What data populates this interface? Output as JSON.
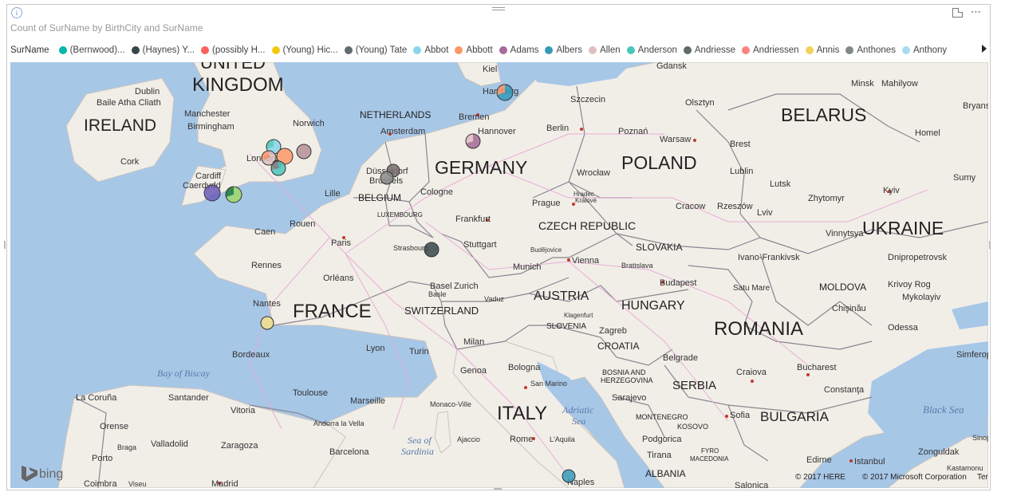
{
  "visual": {
    "title": "Count of SurName by BirthCity and SurName",
    "info_icon": "info-icon",
    "focus_icon": "focus-mode-icon",
    "more_icon": "more-options-icon",
    "more_glyph": "⋯"
  },
  "legend": {
    "title": "SurName",
    "items": [
      {
        "label": "(Bernwood)...",
        "color": "#01b8aa"
      },
      {
        "label": "(Haynes) Y...",
        "color": "#374649"
      },
      {
        "label": "(possibly H...",
        "color": "#fd625e"
      },
      {
        "label": "(Young) Hic...",
        "color": "#f2c80f"
      },
      {
        "label": "(Young) Tate",
        "color": "#5f6b6d"
      },
      {
        "label": "Abbot",
        "color": "#8ad4eb"
      },
      {
        "label": "Abbott",
        "color": "#fe9666"
      },
      {
        "label": "Adams",
        "color": "#a66999"
      },
      {
        "label": "Albers",
        "color": "#3599b8"
      },
      {
        "label": "Allen",
        "color": "#dfbfbf"
      },
      {
        "label": "Anderson",
        "color": "#4ac5bb"
      },
      {
        "label": "Andriesse",
        "color": "#5f6b6d"
      },
      {
        "label": "Andriessen",
        "color": "#fb8281"
      },
      {
        "label": "Annis",
        "color": "#f4d25a"
      },
      {
        "label": "Anthones",
        "color": "#7f898a"
      },
      {
        "label": "Anthony",
        "color": "#a4ddee"
      }
    ]
  },
  "map": {
    "countries": [
      "UNITED KINGDOM",
      "IRELAND",
      "NETHERLANDS",
      "GERMANY",
      "POLAND",
      "BELARUS",
      "BELGIUM",
      "LUXEMBOURG",
      "CZECH REPUBLIC",
      "SLOVAKIA",
      "UKRAINE",
      "FRANCE",
      "SWITZERLAND",
      "AUSTRIA",
      "HUNGARY",
      "ROMANIA",
      "MOLDOVA",
      "SLOVENIA",
      "CROATIA",
      "BOSNIA AND HERZEGOVINA",
      "SERBIA",
      "ITALY",
      "MONTENEGRO",
      "KOSOVO",
      "FYRO MACEDONIA",
      "BULGARIA",
      "ALBANIA"
    ],
    "seas": [
      "Bay of Biscay",
      "Adriatic Sea",
      "Sea of Sardinia",
      "Black Sea"
    ],
    "cities": [
      "Dublin",
      "Baile Atha Cliath",
      "Manchester",
      "Birmingham",
      "Norwich",
      "Cork",
      "Cardiff",
      "Caerdydd",
      "London",
      "Amsterdam",
      "Bremen",
      "Hannover",
      "Hamburg",
      "Kiel",
      "Gdansk",
      "Szczecin",
      "Olsztyn",
      "Minsk",
      "Mahilyow",
      "Bryansk",
      "Homel",
      "Berlin",
      "Poznan",
      "Warsaw",
      "Brest",
      "Lublin",
      "Wroclaw",
      "Dusseldorf",
      "Brussels",
      "Lille",
      "Cologne",
      "Prague",
      "Hradec Kralove",
      "Cracow",
      "Rzeszow",
      "Lviv",
      "Lutsk",
      "Zhytomyr",
      "Kyiv",
      "Sumy",
      "Vinnytsya",
      "Dnipropetrovsk",
      "Ivano-Frankivsk",
      "Krivoy Rog",
      "Mykolayiv",
      "Chisinau",
      "Odessa",
      "Simferopol",
      "Frankfurt",
      "Rouen",
      "Caen",
      "Paris",
      "Rennes",
      "Strasbourg",
      "Stuttgart",
      "Budejovice",
      "Vienna",
      "Bratislava",
      "Munich",
      "Orleans",
      "Basel",
      "Zurich",
      "Vaduz",
      "Budapest",
      "Satu Mare",
      "Nantes",
      "Klagenfurt",
      "Zagreb",
      "Milan",
      "Turin",
      "Genoa",
      "Bologna",
      "Belgrade",
      "Craiova",
      "Bucharest",
      "Constanta",
      "Lyon",
      "Bordeaux",
      "Sarajevo",
      "San Marino",
      "Toulouse",
      "Marseille",
      "Monaco-Ville",
      "Vitoria",
      "Santander",
      "La Coruna",
      "Orense",
      "Braga",
      "Valladolid",
      "Zaragoza",
      "Andorra la Vella",
      "Barcelona",
      "Ajaccio",
      "Rome",
      "L'Aquila",
      "Podgorica",
      "Tirana",
      "Sofia",
      "Edirne",
      "Istanbul",
      "Zonguldak",
      "Kastamonu",
      "Porto",
      "Coimbra",
      "Viseu",
      "Madrid",
      "Naples",
      "Salonica",
      "Sinop"
    ],
    "zoom_value": "",
    "logo": "bing",
    "copyright": "© 2017 HERE",
    "copyright2": "© 2017 Microsoft Corporation",
    "terms": "Ter"
  },
  "bubbles": [
    {
      "city": "Hamburg",
      "colors": [
        "#3599b8",
        "#fe9666"
      ]
    },
    {
      "city": "Hannover",
      "colors": [
        "#a66999",
        "#dfbfbf"
      ]
    },
    {
      "city": "London-1",
      "colors": [
        "#8ad4eb",
        "#4ac5bb"
      ]
    },
    {
      "city": "London-2",
      "colors": [
        "#fe9666"
      ]
    },
    {
      "city": "London-3",
      "colors": [
        "#dfbfbf",
        "#fe9666"
      ]
    },
    {
      "city": "London-4",
      "colors": [
        "#a66999"
      ]
    },
    {
      "city": "London-5",
      "colors": [
        "#4ac5bb",
        "#7f898a"
      ]
    },
    {
      "city": "Norwich",
      "colors": [
        "#b58f98"
      ]
    },
    {
      "city": "Cardiff",
      "colors": [
        "#6b5cb8"
      ]
    },
    {
      "city": "Bristol",
      "colors": [
        "#a0d86a",
        "#1f7a3a"
      ]
    },
    {
      "city": "Dusseldorf-1",
      "colors": [
        "#7a6e6e"
      ]
    },
    {
      "city": "Dusseldorf-2",
      "colors": [
        "#8a8a8a"
      ]
    },
    {
      "city": "Strasbourg",
      "colors": [
        "#374649"
      ]
    },
    {
      "city": "Nantes",
      "colors": [
        "#f4e08a"
      ]
    },
    {
      "city": "Naples",
      "colors": [
        "#3599b8"
      ]
    }
  ]
}
